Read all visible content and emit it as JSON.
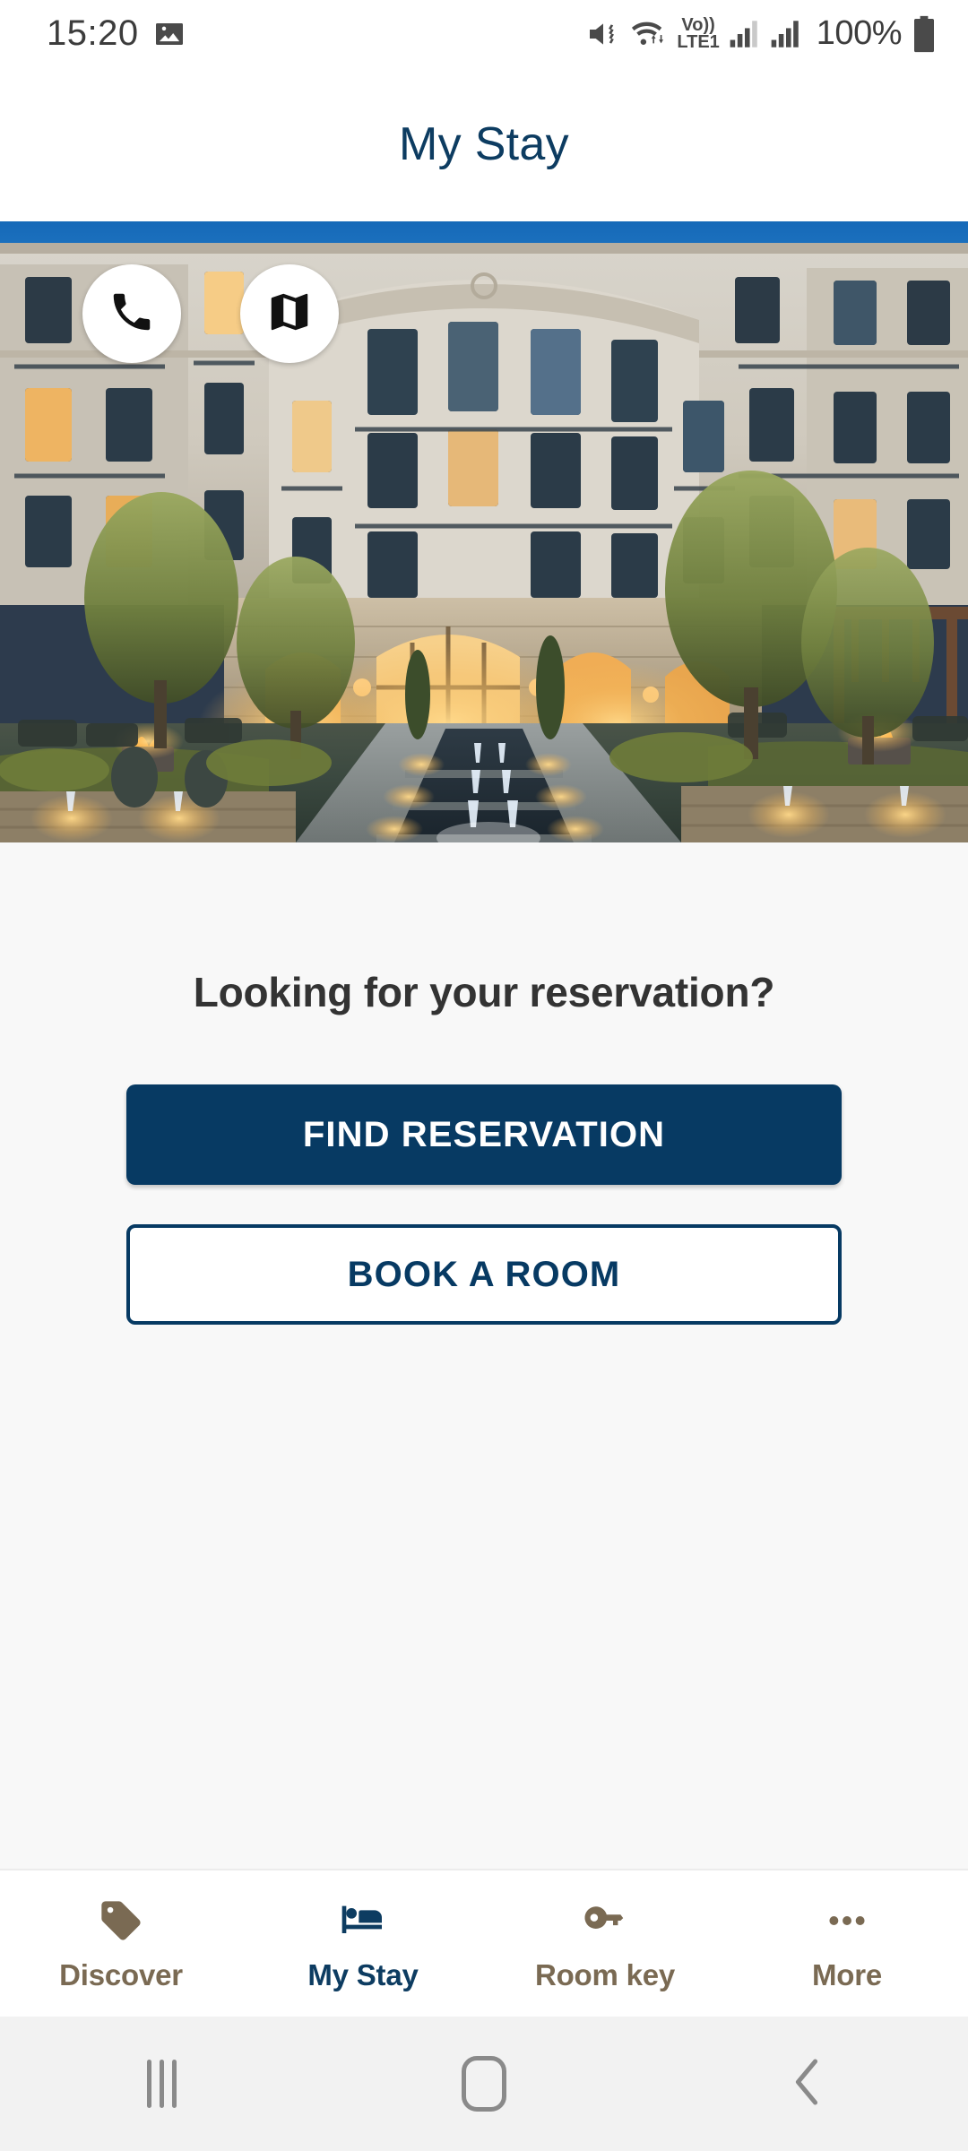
{
  "status_bar": {
    "time": "15:20",
    "battery_percent": "100%",
    "network_label_top": "Vo))",
    "network_label_bottom": "LTE1",
    "icons": [
      "screenshot-icon",
      "mute-vibrate-icon",
      "wifi-icon",
      "volte-icon",
      "signal-bars-sim1-icon",
      "signal-bars-sim2-icon",
      "battery-icon"
    ]
  },
  "header": {
    "title": "My Stay"
  },
  "hero": {
    "alt": "Hotel exterior courtyard at dusk with illuminated water feature",
    "actions": [
      {
        "name": "call-hotel-button",
        "icon": "phone-icon"
      },
      {
        "name": "map-directions-button",
        "icon": "map-icon"
      }
    ]
  },
  "main": {
    "prompt": "Looking for your reservation?",
    "primary_button": "FIND RESERVATION",
    "secondary_button": "BOOK A ROOM"
  },
  "tabbar": {
    "items": [
      {
        "label": "Discover",
        "icon": "tag-icon",
        "active": false
      },
      {
        "label": "My Stay",
        "icon": "bed-icon",
        "active": true
      },
      {
        "label": "Room key",
        "icon": "key-icon",
        "active": false
      },
      {
        "label": "More",
        "icon": "ellipsis-icon",
        "active": false
      }
    ]
  },
  "system_nav": {
    "recents": "recent-apps-icon",
    "home": "home-icon",
    "back": "back-icon"
  },
  "colors": {
    "brand_navy": "#073A63",
    "header_navy": "#0D3C61",
    "tab_inactive": "#7A6A53",
    "content_bg": "#F8F8F8",
    "prompt_text": "#333333"
  }
}
